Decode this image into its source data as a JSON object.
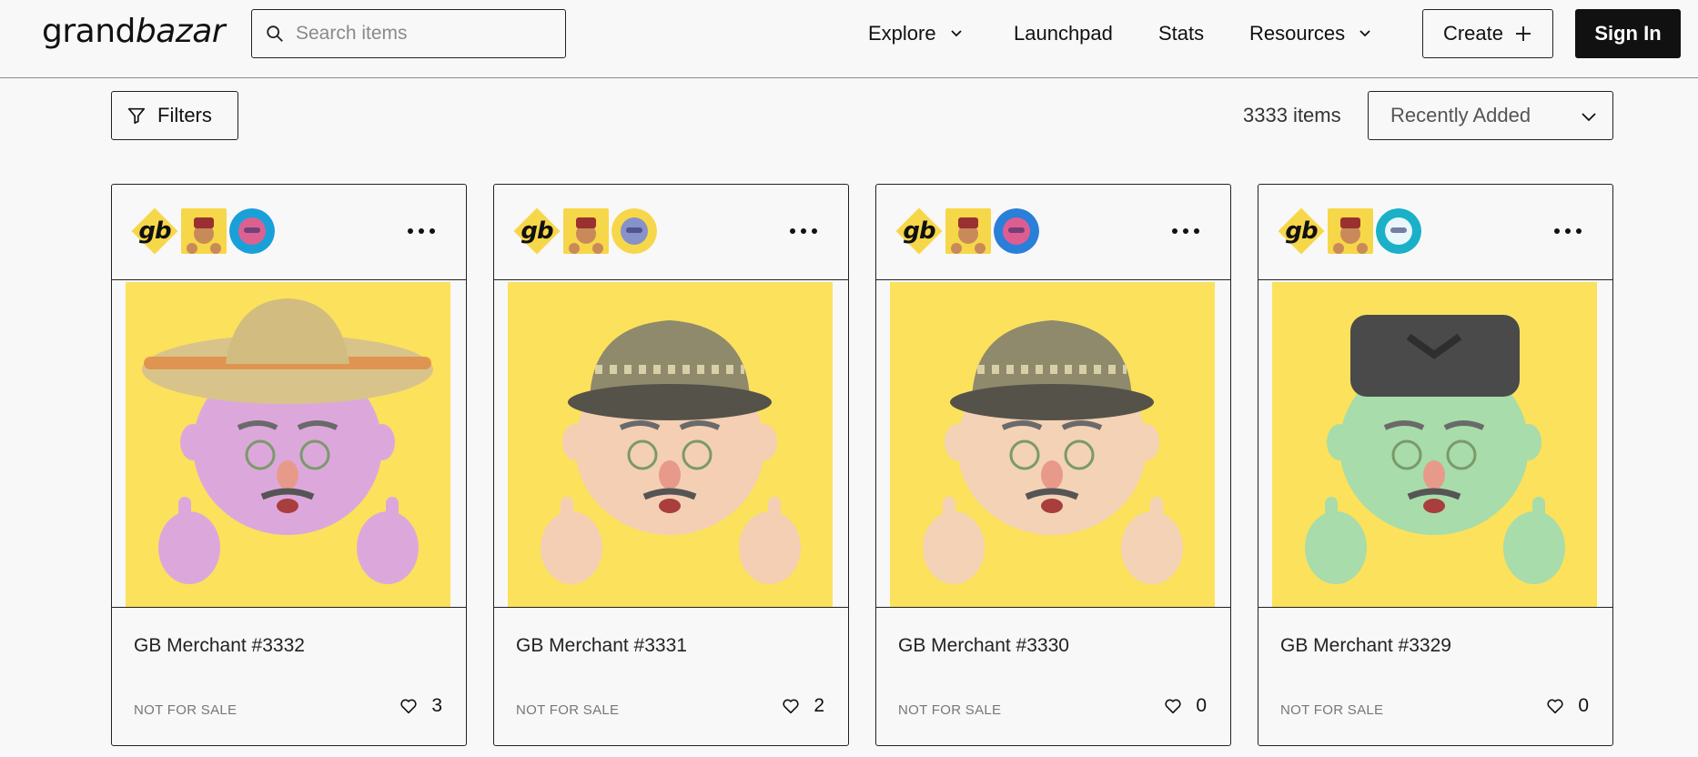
{
  "header": {
    "logo_main": "grand",
    "logo_accent": "bazar",
    "search_placeholder": "Search items",
    "nav": {
      "explore": "Explore",
      "launchpad": "Launchpad",
      "stats": "Stats",
      "resources": "Resources"
    },
    "create_label": "Create",
    "signin_label": "Sign In"
  },
  "toolbar": {
    "filters_label": "Filters",
    "item_count": "3333 items",
    "sort_value": "Recently Added"
  },
  "cards": [
    {
      "title": "GB Merchant #3332",
      "status": "NOT FOR SALE",
      "likes": "3",
      "gb_badge": "gb",
      "skin": "#dca8dc",
      "hat": "sombrero",
      "badge_color": "#1aa0d8",
      "badge_accent": "#f25a8a"
    },
    {
      "title": "GB Merchant #3331",
      "status": "NOT FOR SALE",
      "likes": "2",
      "gb_badge": "gb",
      "skin": "#f4cfb4",
      "hat": "bucket",
      "badge_color": "#f7d74a",
      "badge_accent": "#7a8ad8"
    },
    {
      "title": "GB Merchant #3330",
      "status": "NOT FOR SALE",
      "likes": "0",
      "gb_badge": "gb",
      "skin": "#f4d2b6",
      "hat": "bucket",
      "badge_color": "#2a7fd8",
      "badge_accent": "#f25a8a"
    },
    {
      "title": "GB Merchant #3329",
      "status": "NOT FOR SALE",
      "likes": "0",
      "gb_badge": "gb",
      "skin": "#a8dcaa",
      "hat": "kufi",
      "badge_color": "#1ab0c8",
      "badge_accent": "#ffffff"
    }
  ],
  "icons": {
    "search": "search-icon",
    "chevron": "chevron-down-icon",
    "plus": "plus-icon",
    "filter": "filter-icon",
    "more": "more-icon",
    "heart": "heart-icon"
  }
}
